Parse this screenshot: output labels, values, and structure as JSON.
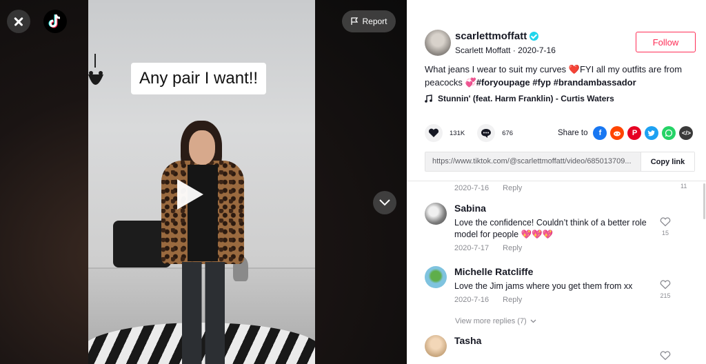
{
  "video": {
    "caption": "Any pair I want!!",
    "report_label": "Report"
  },
  "author": {
    "handle": "scarlettmoffatt",
    "display_name": "Scarlett Moffatt",
    "date": "2020-7-16",
    "verified": true,
    "follow_label": "Follow"
  },
  "description": {
    "text1": "What jeans I wear to suit my curves ",
    "text2": "FYI all my outfits are from peacocks ",
    "hashtags": [
      "#foryoupage",
      "#fyp",
      "#brandambassador"
    ]
  },
  "music": {
    "title": "Stunnin' (feat. Harm Franklin) - Curtis Waters"
  },
  "actions": {
    "likes": "131K",
    "comments": "676",
    "share_label": "Share to",
    "share_targets": [
      "facebook-icon",
      "reddit-icon",
      "pinterest-icon",
      "twitter-icon",
      "whatsapp-icon",
      "embed-icon"
    ]
  },
  "link": {
    "url": "https://www.tiktok.com/@scarlettmoffatt/video/685013709...",
    "copy_label": "Copy link"
  },
  "comments": {
    "top_partial": {
      "date": "2020-7-16",
      "reply_label": "Reply",
      "likes": "11"
    },
    "items": [
      {
        "name": "Sabina",
        "text": "Love the confidence! Couldn’t think of a better role model for people 💖💖💖",
        "date": "2020-7-17",
        "reply_label": "Reply",
        "likes": "15"
      },
      {
        "name": "Michelle Ratcliffe",
        "text": "Love the Jim jams where you get them from xx",
        "date": "2020-7-16",
        "reply_label": "Reply",
        "likes": "215"
      },
      {
        "name": "Tasha",
        "text": "",
        "date": "",
        "reply_label": "",
        "likes": ""
      }
    ],
    "view_more": "View more replies (7)"
  },
  "colors": {
    "accent": "#fe2c55",
    "facebook": "#1877f2",
    "reddit": "#ff4500",
    "pinterest": "#e60023",
    "twitter": "#1da1f2",
    "whatsapp": "#25d366",
    "embed": "#3a3a3a"
  }
}
